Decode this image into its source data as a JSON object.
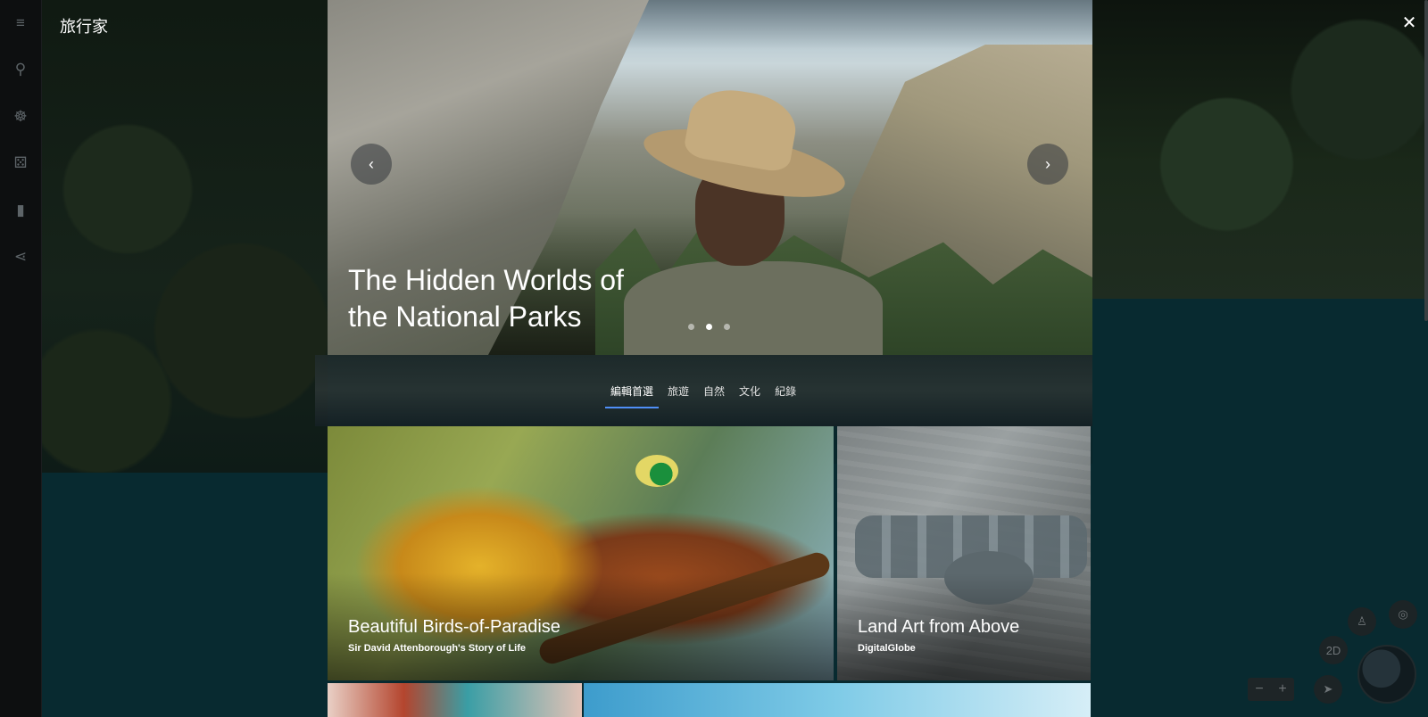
{
  "app": {
    "title": "旅行家"
  },
  "rail": {
    "items": [
      {
        "name": "menu-icon",
        "glyph": "≡"
      },
      {
        "name": "search-icon",
        "glyph": "⚲"
      },
      {
        "name": "voyager-icon",
        "glyph": "☸"
      },
      {
        "name": "dice-icon",
        "glyph": "⚄"
      },
      {
        "name": "bookmark-icon",
        "glyph": "▮"
      },
      {
        "name": "share-icon",
        "glyph": "⋖"
      }
    ]
  },
  "hero": {
    "title": "The Hidden Worlds of the National Parks",
    "prev_glyph": "‹",
    "next_glyph": "›",
    "slides": 3,
    "active_slide": 2
  },
  "tabs": [
    {
      "label": "編輯首選",
      "active": true
    },
    {
      "label": "旅遊",
      "active": false
    },
    {
      "label": "自然",
      "active": false
    },
    {
      "label": "文化",
      "active": false
    },
    {
      "label": "紀錄",
      "active": false
    }
  ],
  "cards": [
    {
      "title": "Beautiful Birds-of-Paradise",
      "subtitle": "Sir David Attenborough's Story of Life"
    },
    {
      "title": "Land Art from Above",
      "subtitle": "DigitalGlobe"
    }
  ],
  "close_glyph": "✕",
  "map_controls": {
    "pegman_glyph": "♙",
    "locate_glyph": "◎",
    "mode_label": "2D",
    "compass_glyph": "➤",
    "zoom_out": "−",
    "zoom_in": "+"
  },
  "colors": {
    "accent": "#4f8ff7"
  }
}
